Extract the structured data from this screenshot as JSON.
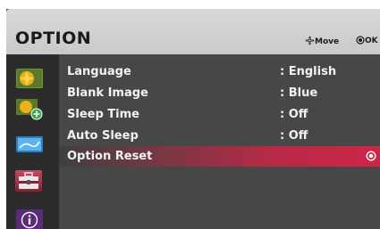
{
  "menu": {
    "title": "OPTION",
    "hints": {
      "move_label": "Move",
      "ok_label": "OK",
      "move_icon": "four-way-arrow-icon",
      "ok_icon": "ok-circle-icon"
    },
    "categories": [
      {
        "icon": "picture-menu-icon"
      },
      {
        "icon": "picture-plus-menu-icon"
      },
      {
        "icon": "screen-menu-icon"
      },
      {
        "icon": "toolbox-option-menu-icon",
        "selected": true
      },
      {
        "icon": "info-menu-icon"
      }
    ],
    "items": [
      {
        "label": "Language",
        "value": ": English"
      },
      {
        "label": "Blank Image",
        "value": ": Blue"
      },
      {
        "label": "Sleep Time",
        "value": ": Off"
      },
      {
        "label": "Auto Sleep",
        "value": ": Off"
      },
      {
        "label": "Option Reset",
        "value": "",
        "selected": true
      }
    ],
    "colors": {
      "highlight": "#cf2547",
      "panel": "#414141",
      "header": "#d4d4d4"
    }
  }
}
